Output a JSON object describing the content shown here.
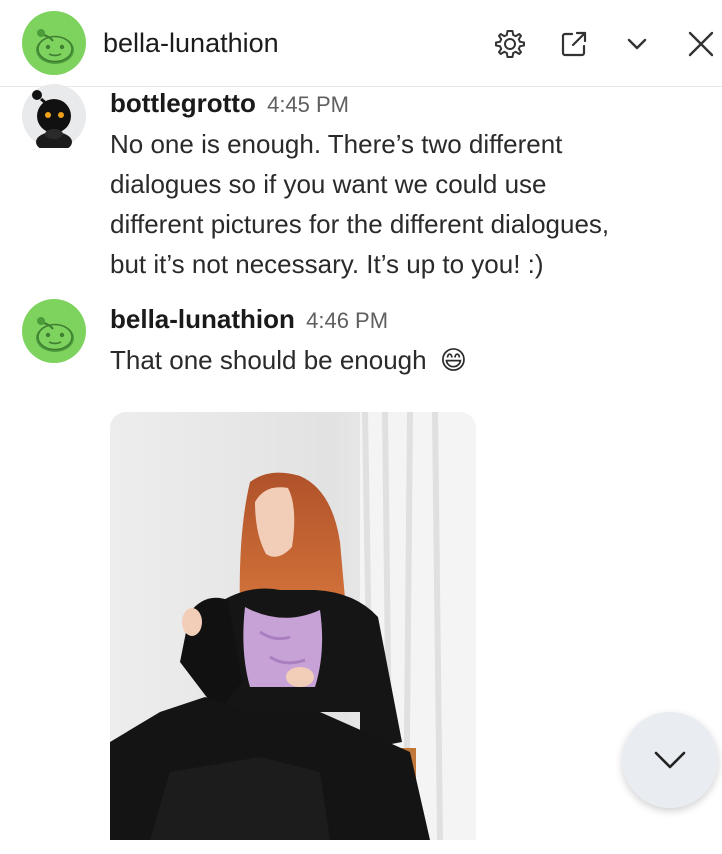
{
  "header": {
    "title": "bella-lunathion",
    "icons": [
      "gear-icon",
      "external-link-icon",
      "chevron-down-icon",
      "close-icon"
    ]
  },
  "messages": [
    {
      "username": "bottlegrotto",
      "time": "4:45 PM",
      "lines": [
        "No one is enough. There’s two different",
        "dialogues so if you want we could use",
        "different pictures for the different dialogues,",
        "but it’s not necessary. It’s up to you! :)"
      ]
    },
    {
      "username": "bella-lunathion",
      "time": "4:46 PM",
      "lines": [
        "That one should be enough"
      ],
      "emoji": "😄"
    }
  ],
  "colors": {
    "avatar_green": "#7ed35f",
    "accent_dark": "#1a1a1b",
    "scroll_button": "#e9edf1"
  }
}
